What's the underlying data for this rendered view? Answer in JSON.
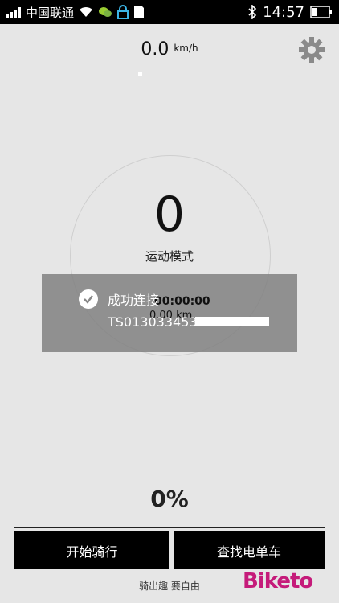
{
  "status_bar": {
    "carrier": "中国联通",
    "time": "14:57"
  },
  "speed": {
    "value": "0.0",
    "unit": "km/h"
  },
  "counter": {
    "value": "0",
    "mode_label": "运动模式"
  },
  "toast": {
    "message": "成功连接",
    "duration": "00:00:00",
    "distance": "0.00 km",
    "serial": "TS013033453"
  },
  "battery_percent": "0%",
  "buttons": {
    "start": "开始骑行",
    "find": "查找电单车"
  },
  "footer": "骑出趣 要自由",
  "watermark": "Biketo"
}
